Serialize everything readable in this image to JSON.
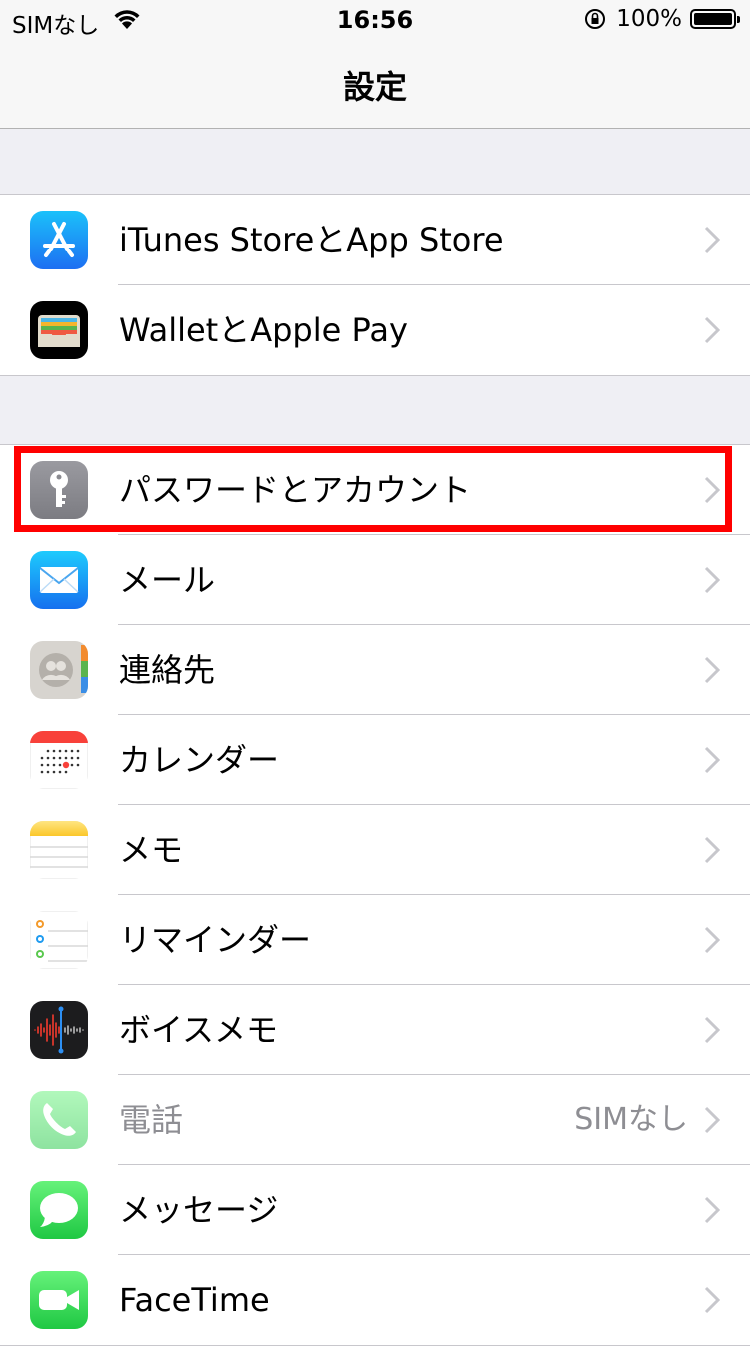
{
  "status_bar": {
    "carrier": "SIMなし",
    "time": "16:56",
    "battery": "100%"
  },
  "nav": {
    "title": "設定"
  },
  "groups": [
    {
      "items": [
        {
          "label": "iTunes StoreとApp Store",
          "icon": "app-store-icon"
        },
        {
          "label": "WalletとApple Pay",
          "icon": "wallet-icon"
        }
      ]
    },
    {
      "items": [
        {
          "label": "パスワードとアカウント",
          "icon": "key-icon",
          "highlighted": true
        },
        {
          "label": "メール",
          "icon": "mail-icon"
        },
        {
          "label": "連絡先",
          "icon": "contacts-icon"
        },
        {
          "label": "カレンダー",
          "icon": "calendar-icon"
        },
        {
          "label": "メモ",
          "icon": "notes-icon"
        },
        {
          "label": "リマインダー",
          "icon": "reminders-icon"
        },
        {
          "label": "ボイスメモ",
          "icon": "voice-memos-icon"
        },
        {
          "label": "電話",
          "icon": "phone-icon",
          "detail": "SIMなし",
          "disabled": true
        },
        {
          "label": "メッセージ",
          "icon": "messages-icon"
        },
        {
          "label": "FaceTime",
          "icon": "facetime-icon"
        }
      ]
    }
  ],
  "colors": {
    "highlight": "#ff0000",
    "background": "#efeff4",
    "separator": "#c8c7cc"
  }
}
